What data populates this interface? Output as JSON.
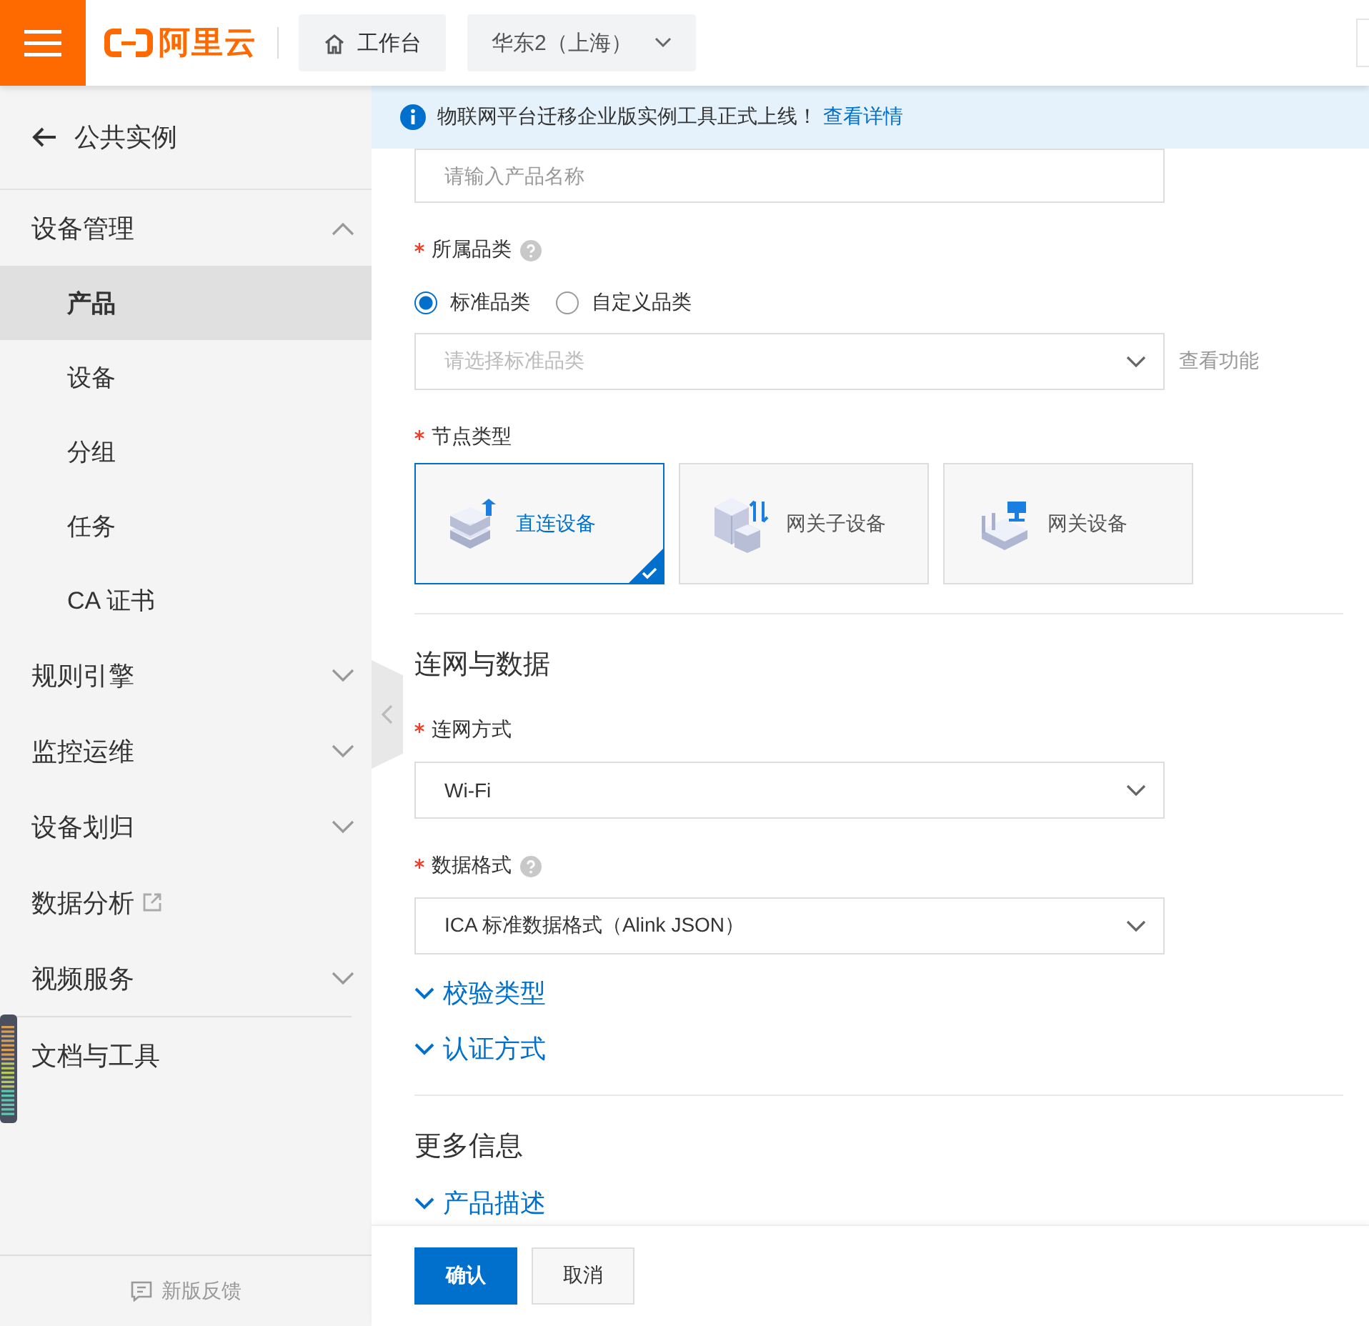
{
  "header": {
    "logo_text": "阿里云",
    "workbench": "工作台",
    "region": "华东2（上海）"
  },
  "sidebar": {
    "back": "公共实例",
    "items": [
      {
        "label": "设备管理",
        "kind": "group",
        "expanded": true,
        "children": [
          {
            "label": "产品",
            "selected": true
          },
          {
            "label": "设备",
            "selected": false
          },
          {
            "label": "分组",
            "selected": false
          },
          {
            "label": "任务",
            "selected": false
          },
          {
            "label": "CA 证书",
            "selected": false
          }
        ]
      },
      {
        "label": "规则引擎",
        "kind": "group",
        "expanded": false
      },
      {
        "label": "监控运维",
        "kind": "group",
        "expanded": false
      },
      {
        "label": "设备划归",
        "kind": "group",
        "expanded": false
      },
      {
        "label": "数据分析",
        "kind": "external"
      },
      {
        "label": "视频服务",
        "kind": "group",
        "expanded": false
      },
      {
        "label": "文档与工具",
        "kind": "plain"
      }
    ],
    "feedback": "新版反馈"
  },
  "banner": {
    "text": "物联网平台迁移企业版实例工具正式上线！",
    "link": "查看详情"
  },
  "form": {
    "name_field": {
      "placeholder": "请输入产品名称"
    },
    "category": {
      "label": "所属品类",
      "required": true,
      "help": true,
      "options": [
        {
          "label": "标准品类",
          "selected": true
        },
        {
          "label": "自定义品类",
          "selected": false
        }
      ],
      "select_placeholder": "请选择标准品类",
      "action": "查看功能"
    },
    "node_type": {
      "label": "节点类型",
      "required": true,
      "options": [
        {
          "label": "直连设备",
          "kind": "direct",
          "selected": true
        },
        {
          "label": "网关子设备",
          "kind": "subdevice",
          "selected": false
        },
        {
          "label": "网关设备",
          "kind": "gateway",
          "selected": false
        }
      ]
    },
    "network_section": {
      "title": "连网与数据",
      "fields": [
        {
          "label": "连网方式",
          "required": true,
          "help": false,
          "value": "Wi-Fi"
        },
        {
          "label": "数据格式",
          "required": true,
          "help": true,
          "value": "ICA 标准数据格式（Alink JSON）"
        }
      ],
      "toggles": [
        {
          "label": "校验类型",
          "expanded": false
        },
        {
          "label": "认证方式",
          "expanded": false
        }
      ]
    },
    "more_section": {
      "title": "更多信息",
      "toggles": [
        {
          "label": "产品描述",
          "expanded": false
        }
      ]
    }
  },
  "footer": {
    "buttons": [
      {
        "label": "确认",
        "kind": "primary"
      },
      {
        "label": "取消",
        "kind": "secondary"
      }
    ]
  }
}
